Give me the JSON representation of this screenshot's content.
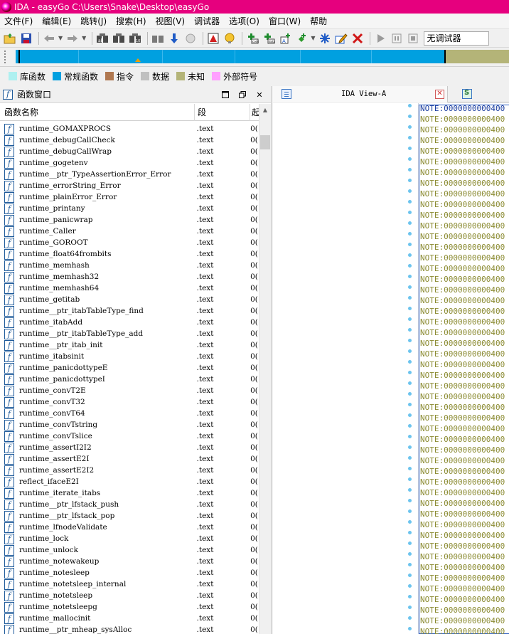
{
  "window": {
    "title": "IDA - easyGo C:\\Users\\Snake\\Desktop\\easyGo"
  },
  "menu": [
    "文件(F)",
    "编辑(E)",
    "跳转(J)",
    "搜索(H)",
    "视图(V)",
    "调试器",
    "选项(O)",
    "窗口(W)",
    "帮助"
  ],
  "toolbar": {
    "debugger_select": "无调试器"
  },
  "legend": [
    {
      "label": "库函数",
      "color": "#aef0f0"
    },
    {
      "label": "常规函数",
      "color": "#00a0e0"
    },
    {
      "label": "指令",
      "color": "#b07850"
    },
    {
      "label": "数据",
      "color": "#c0c0c0"
    },
    {
      "label": "未知",
      "color": "#b4b478"
    },
    {
      "label": "外部符号",
      "color": "#ffa0ff"
    }
  ],
  "functions_window": {
    "title": "函数窗口",
    "columns": {
      "name": "函数名称",
      "segment": "段",
      "start": "起"
    },
    "rows": [
      {
        "name": "runtime_GOMAXPROCS",
        "segment": ".text",
        "start": "0("
      },
      {
        "name": "runtime_debugCallCheck",
        "segment": ".text",
        "start": "0("
      },
      {
        "name": "runtime_debugCallWrap",
        "segment": ".text",
        "start": "0("
      },
      {
        "name": "runtime_gogetenv",
        "segment": ".text",
        "start": "0("
      },
      {
        "name": "runtime__ptr_TypeAssertionError_Error",
        "segment": ".text",
        "start": "0("
      },
      {
        "name": "runtime_errorString_Error",
        "segment": ".text",
        "start": "0("
      },
      {
        "name": "runtime_plainError_Error",
        "segment": ".text",
        "start": "0("
      },
      {
        "name": "runtime_printany",
        "segment": ".text",
        "start": "0("
      },
      {
        "name": "runtime_panicwrap",
        "segment": ".text",
        "start": "0("
      },
      {
        "name": "runtime_Caller",
        "segment": ".text",
        "start": "0("
      },
      {
        "name": "runtime_GOROOT",
        "segment": ".text",
        "start": "0("
      },
      {
        "name": "runtime_float64frombits",
        "segment": ".text",
        "start": "0("
      },
      {
        "name": "runtime_memhash",
        "segment": ".text",
        "start": "0("
      },
      {
        "name": "runtime_memhash32",
        "segment": ".text",
        "start": "0("
      },
      {
        "name": "runtime_memhash64",
        "segment": ".text",
        "start": "0("
      },
      {
        "name": "runtime_getitab",
        "segment": ".text",
        "start": "0("
      },
      {
        "name": "runtime__ptr_itabTableType_find",
        "segment": ".text",
        "start": "0("
      },
      {
        "name": "runtime_itabAdd",
        "segment": ".text",
        "start": "0("
      },
      {
        "name": "runtime__ptr_itabTableType_add",
        "segment": ".text",
        "start": "0("
      },
      {
        "name": "runtime__ptr_itab_init",
        "segment": ".text",
        "start": "0("
      },
      {
        "name": "runtime_itabsinit",
        "segment": ".text",
        "start": "0("
      },
      {
        "name": "runtime_panicdottypeE",
        "segment": ".text",
        "start": "0("
      },
      {
        "name": "runtime_panicdottypeI",
        "segment": ".text",
        "start": "0("
      },
      {
        "name": "runtime_convT2E",
        "segment": ".text",
        "start": "0("
      },
      {
        "name": "runtime_convT32",
        "segment": ".text",
        "start": "0("
      },
      {
        "name": "runtime_convT64",
        "segment": ".text",
        "start": "0("
      },
      {
        "name": "runtime_convTstring",
        "segment": ".text",
        "start": "0("
      },
      {
        "name": "runtime_convTslice",
        "segment": ".text",
        "start": "0("
      },
      {
        "name": "runtime_assertI2I2",
        "segment": ".text",
        "start": "0("
      },
      {
        "name": "runtime_assertE2I",
        "segment": ".text",
        "start": "0("
      },
      {
        "name": "runtime_assertE2I2",
        "segment": ".text",
        "start": "0("
      },
      {
        "name": "reflect_ifaceE2I",
        "segment": ".text",
        "start": "0("
      },
      {
        "name": "runtime_iterate_itabs",
        "segment": ".text",
        "start": "0("
      },
      {
        "name": "runtime__ptr_lfstack_push",
        "segment": ".text",
        "start": "0("
      },
      {
        "name": "runtime__ptr_lfstack_pop",
        "segment": ".text",
        "start": "0("
      },
      {
        "name": "runtime_lfnodeValidate",
        "segment": ".text",
        "start": "0("
      },
      {
        "name": "runtime_lock",
        "segment": ".text",
        "start": "0("
      },
      {
        "name": "runtime_unlock",
        "segment": ".text",
        "start": "0("
      },
      {
        "name": "runtime_notewakeup",
        "segment": ".text",
        "start": "0("
      },
      {
        "name": "runtime_notesleep",
        "segment": ".text",
        "start": "0("
      },
      {
        "name": "runtime_notetsleep_internal",
        "segment": ".text",
        "start": "0("
      },
      {
        "name": "runtime_notetsleep",
        "segment": ".text",
        "start": "0("
      },
      {
        "name": "runtime_notetsleepg",
        "segment": ".text",
        "start": "0("
      },
      {
        "name": "runtime_mallocinit",
        "segment": ".text",
        "start": "0("
      },
      {
        "name": "runtime__ptr_mheap_sysAlloc",
        "segment": ".text",
        "start": "0("
      }
    ]
  },
  "ida_view": {
    "tab_label": "IDA View-A",
    "lines": [
      "NOTE:0000000000400",
      "NOTE:0000000000400",
      "NOTE:0000000000400",
      "NOTE:0000000000400",
      "NOTE:0000000000400",
      "NOTE:0000000000400",
      "NOTE:0000000000400",
      "NOTE:0000000000400",
      "NOTE:0000000000400",
      "NOTE:0000000000400",
      "NOTE:0000000000400",
      "NOTE:0000000000400",
      "NOTE:0000000000400",
      "NOTE:0000000000400",
      "NOTE:0000000000400",
      "NOTE:0000000000400",
      "NOTE:0000000000400",
      "NOTE:0000000000400",
      "NOTE:0000000000400",
      "NOTE:0000000000400",
      "NOTE:0000000000400",
      "NOTE:0000000000400",
      "NOTE:0000000000400",
      "NOTE:0000000000400",
      "NOTE:0000000000400",
      "NOTE:0000000000400",
      "NOTE:0000000000400",
      "NOTE:0000000000400",
      "NOTE:0000000000400",
      "NOTE:0000000000400",
      "NOTE:0000000000400",
      "NOTE:0000000000400",
      "NOTE:0000000000400",
      "NOTE:0000000000400",
      "NOTE:0000000000400",
      "NOTE:0000000000400",
      "NOTE:0000000000400",
      "NOTE:0000000000400",
      "NOTE:0000000000400",
      "NOTE:0000000000400",
      "NOTE:0000000000400",
      "NOTE:0000000000400",
      "NOTE:0000000000400",
      "NOTE:0000000000400",
      "NOTE:0000000000400",
      "NOTE:0000000000400",
      "NOTE:0000000000400",
      "NOTE:0000000000400",
      "NOTE:0000000000400",
      "NOTE:0000000000400"
    ]
  },
  "icons": [
    "app-icon",
    "open-icon",
    "save-icon",
    "back-icon",
    "forward-icon",
    "search-icon",
    "jump-icon",
    "graph-icon",
    "add-icon",
    "stop-icon",
    "run-icon",
    "pause-icon",
    "function-icon",
    "close-icon"
  ]
}
